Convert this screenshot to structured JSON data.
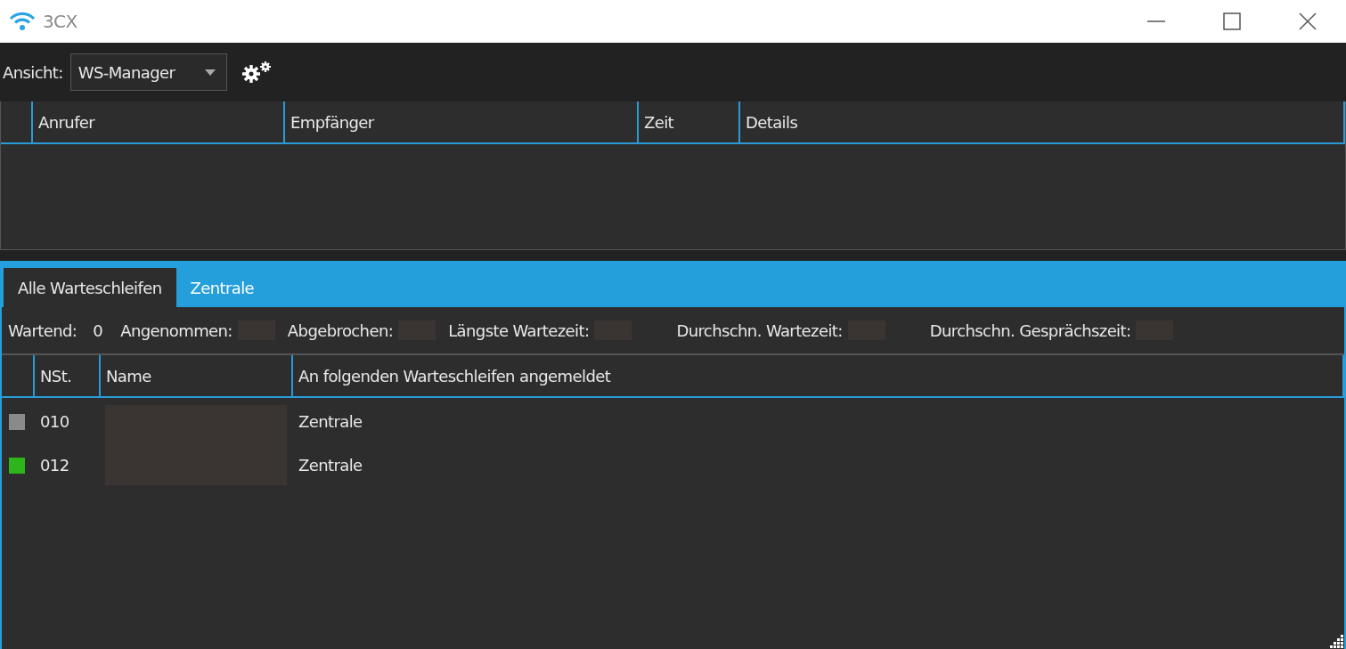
{
  "window": {
    "title": "3CX"
  },
  "toolbar": {
    "view_label": "Ansicht:",
    "view_value": "WS-Manager"
  },
  "calls_table": {
    "columns": [
      "Anrufer",
      "Empfänger",
      "Zeit",
      "Details"
    ]
  },
  "tabs": [
    {
      "label": "Alle Warteschleifen",
      "selected": true
    },
    {
      "label": "Zentrale",
      "selected": false
    }
  ],
  "stats": [
    {
      "label": "Wartend:",
      "value": "0"
    },
    {
      "label": "Angenommen:"
    },
    {
      "label": "Abgebrochen:"
    },
    {
      "label": "Längste Wartezeit:"
    },
    {
      "label": "Durchschn. Wartezeit:"
    },
    {
      "label": "Durchschn. Gesprächszeit:"
    }
  ],
  "agents_table": {
    "columns": [
      "NSt.",
      "Name",
      "An folgenden Warteschleifen angemeldet"
    ],
    "rows": [
      {
        "color": "#8a8a8a",
        "extension": "010",
        "queues": "Zentrale"
      },
      {
        "color": "#2fb51c",
        "extension": "012",
        "queues": "Zentrale"
      }
    ]
  }
}
